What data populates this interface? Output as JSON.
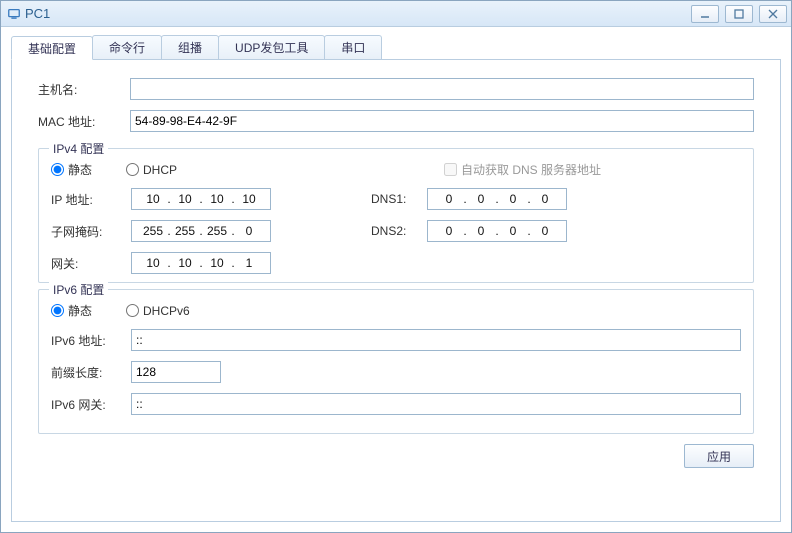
{
  "window": {
    "title": "PC1"
  },
  "tabs": [
    {
      "label": "基础配置"
    },
    {
      "label": "命令行"
    },
    {
      "label": "组播"
    },
    {
      "label": "UDP发包工具"
    },
    {
      "label": "串口"
    }
  ],
  "basic": {
    "hostname_label": "主机名:",
    "hostname_value": "",
    "mac_label": "MAC 地址:",
    "mac_value": "54-89-98-E4-42-9F"
  },
  "ipv4": {
    "legend": "IPv4 配置",
    "radio_static": "静态",
    "radio_dhcp": "DHCP",
    "auto_dns_checkbox": "自动获取 DNS 服务器地址",
    "ip_label": "IP 地址:",
    "ip": [
      "10",
      "10",
      "10",
      "10"
    ],
    "mask_label": "子网掩码:",
    "mask": [
      "255",
      "255",
      "255",
      "0"
    ],
    "gateway_label": "网关:",
    "gateway": [
      "10",
      "10",
      "10",
      "1"
    ],
    "dns1_label": "DNS1:",
    "dns1": [
      "0",
      "0",
      "0",
      "0"
    ],
    "dns2_label": "DNS2:",
    "dns2": [
      "0",
      "0",
      "0",
      "0"
    ]
  },
  "ipv6": {
    "legend": "IPv6 配置",
    "radio_static": "静态",
    "radio_dhcpv6": "DHCPv6",
    "addr_label": "IPv6 地址:",
    "addr_value": "::",
    "prefix_label": "前缀长度:",
    "prefix_value": "128",
    "gateway_label": "IPv6 网关:",
    "gateway_value": "::"
  },
  "buttons": {
    "apply": "应用"
  }
}
